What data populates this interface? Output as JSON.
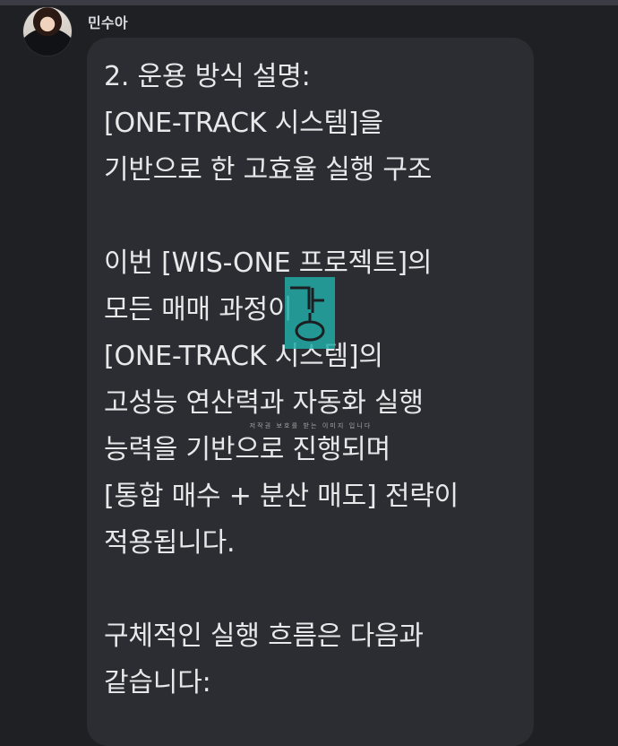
{
  "chat": {
    "sender": "민수아",
    "message": "2. 운용 방식 설명:\n[ONE-TRACK 시스템]을\n기반으로 한 고효율 실행 구조\n\n이번 [WIS-ONE 프로젝트]의\n모든 매매 과정이\n[ONE-TRACK 시스템]의\n고성능 연산력과 자동화 실행\n능력을 기반으로 진행되며\n[통합 매수 + 분산 매도] 전략이\n적용됩니다.\n\n구체적인 실행 흐름은 다음과\n같습니다:"
  },
  "watermark": {
    "text": "저작권 보호를 받는 이미지 입니다"
  },
  "colors": {
    "background": "#1f2024",
    "bubble": "#2b2d32",
    "text": "#e7e8ea",
    "watermark_logo": "#22aaa6"
  }
}
